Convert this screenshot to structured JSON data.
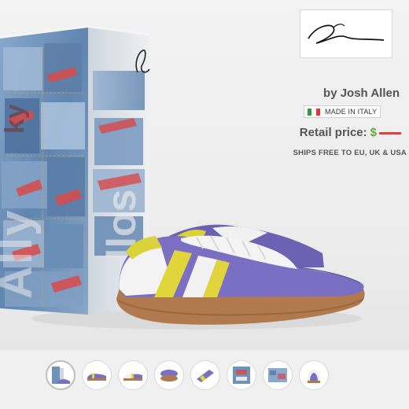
{
  "product": {
    "designer": "by Josh Allen",
    "made_in": "MADE IN ITALY",
    "retail_label": "Retail price:",
    "currency": "$",
    "shipping": "SHIPS FREE TO EU, UK & USA"
  },
  "box_art_text": "Ally Ceballos",
  "colors": {
    "shoe_upper": "#7a6fc2",
    "stripe": "#e0d53a",
    "sole": "#b07a4e",
    "price": "#5cab3c",
    "price_redacted": "#e04040",
    "denim": "#6f92b8"
  },
  "thumbnails": [
    {
      "label": "box-view",
      "active": true
    },
    {
      "label": "side-view-1",
      "active": false
    },
    {
      "label": "side-view-2",
      "active": false
    },
    {
      "label": "sole-view",
      "active": false
    },
    {
      "label": "top-view",
      "active": false
    },
    {
      "label": "box-front",
      "active": false
    },
    {
      "label": "pattern",
      "active": false
    },
    {
      "label": "front-view",
      "active": false
    }
  ]
}
